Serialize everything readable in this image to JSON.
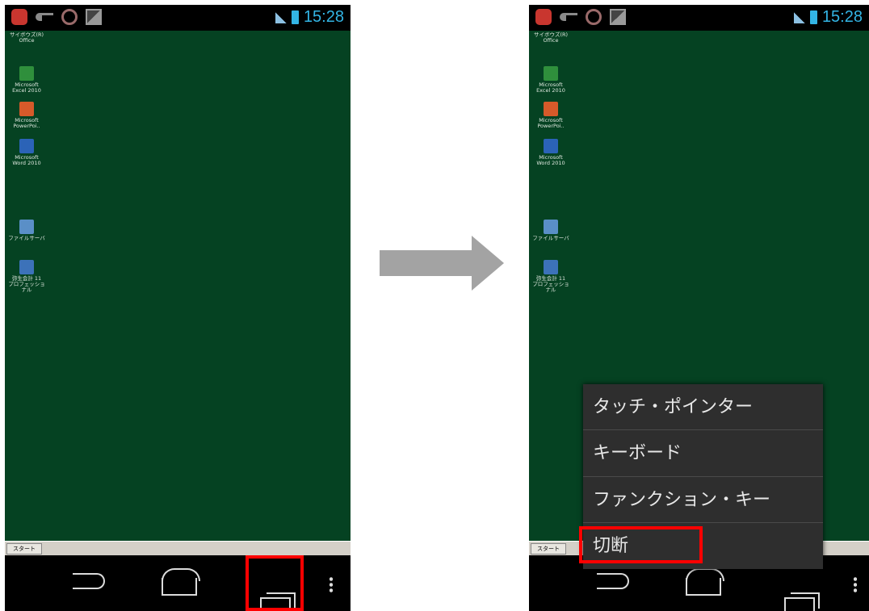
{
  "status_bar": {
    "time": "15:28"
  },
  "desktop_icons": [
    {
      "label": "サイボウズ(R)\nOffice"
    },
    {
      "label": "Microsoft\nExcel 2010"
    },
    {
      "label": "Microsoft\nPowerPoi.."
    },
    {
      "label": "Microsoft\nWord 2010"
    },
    {
      "label": "ファイルサーバ"
    },
    {
      "label": "弥生会計 11\nプロフェッショナル"
    }
  ],
  "taskbar": {
    "start_label": "スタート"
  },
  "popup_menu": {
    "items": [
      {
        "label": "タッチ・ポインター"
      },
      {
        "label": "キーボード"
      },
      {
        "label": "ファンクション・キー"
      },
      {
        "label": "切断"
      }
    ]
  },
  "colors": {
    "desktop": "#054222",
    "highlight": "#ff0000",
    "menu_bg": "#2e2e2e",
    "clock": "#33b5e5"
  }
}
